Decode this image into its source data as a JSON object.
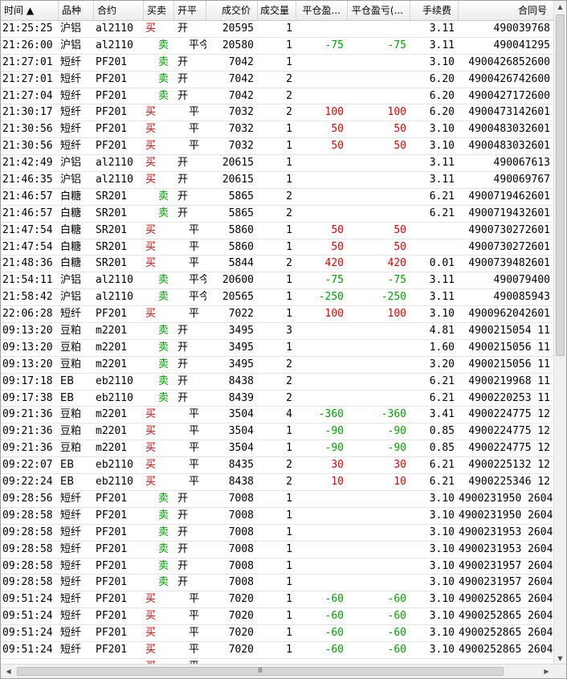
{
  "columns": [
    "时间 ▲",
    "品种",
    "合约",
    "买卖",
    "开平",
    "成交价",
    "成交量",
    "平仓盈...",
    "平仓盈亏(...",
    "手续费",
    "合同号"
  ],
  "rows": [
    [
      "21:25:25",
      "沪铝",
      "al2110",
      "买",
      "开",
      "20595",
      "1",
      "",
      "",
      "3.11",
      "490039768"
    ],
    [
      "21:26:00",
      "沪铝",
      "al2110",
      "卖",
      "平今",
      "20580",
      "1",
      "-75",
      "-75",
      "3.11",
      "490041295"
    ],
    [
      "21:27:01",
      "短纤",
      "PF201",
      "卖",
      "开",
      "7042",
      "1",
      "",
      "",
      "3.10",
      "4900426852600"
    ],
    [
      "21:27:01",
      "短纤",
      "PF201",
      "卖",
      "开",
      "7042",
      "2",
      "",
      "",
      "6.20",
      "4900426742600"
    ],
    [
      "21:27:04",
      "短纤",
      "PF201",
      "卖",
      "开",
      "7042",
      "2",
      "",
      "",
      "6.20",
      "4900427172600"
    ],
    [
      "21:30:17",
      "短纤",
      "PF201",
      "买",
      "平",
      "7032",
      "2",
      "100",
      "100",
      "6.20",
      "4900473142601"
    ],
    [
      "21:30:56",
      "短纤",
      "PF201",
      "买",
      "平",
      "7032",
      "1",
      "50",
      "50",
      "3.10",
      "4900483032601"
    ],
    [
      "21:30:56",
      "短纤",
      "PF201",
      "买",
      "平",
      "7032",
      "1",
      "50",
      "50",
      "3.10",
      "4900483032601"
    ],
    [
      "21:42:49",
      "沪铝",
      "al2110",
      "买",
      "开",
      "20615",
      "1",
      "",
      "",
      "3.11",
      "490067613"
    ],
    [
      "21:46:35",
      "沪铝",
      "al2110",
      "买",
      "开",
      "20615",
      "1",
      "",
      "",
      "3.11",
      "490069767"
    ],
    [
      "21:46:57",
      "白糖",
      "SR201",
      "卖",
      "开",
      "5865",
      "2",
      "",
      "",
      "6.21",
      "4900719462601"
    ],
    [
      "21:46:57",
      "白糖",
      "SR201",
      "卖",
      "开",
      "5865",
      "2",
      "",
      "",
      "6.21",
      "4900719432601"
    ],
    [
      "21:47:54",
      "白糖",
      "SR201",
      "买",
      "平",
      "5860",
      "1",
      "50",
      "50",
      "",
      "4900730272601"
    ],
    [
      "21:47:54",
      "白糖",
      "SR201",
      "买",
      "平",
      "5860",
      "1",
      "50",
      "50",
      "",
      "4900730272601"
    ],
    [
      "21:48:36",
      "白糖",
      "SR201",
      "买",
      "平",
      "5844",
      "2",
      "420",
      "420",
      "0.01",
      "4900739482601"
    ],
    [
      "21:54:11",
      "沪铝",
      "al2110",
      "卖",
      "平今",
      "20600",
      "1",
      "-75",
      "-75",
      "3.11",
      "490079400"
    ],
    [
      "21:58:42",
      "沪铝",
      "al2110",
      "卖",
      "平今",
      "20565",
      "1",
      "-250",
      "-250",
      "3.11",
      "490085943"
    ],
    [
      "22:06:28",
      "短纤",
      "PF201",
      "买",
      "平",
      "7022",
      "1",
      "100",
      "100",
      "3.10",
      "4900962042601"
    ],
    [
      "09:13:20",
      "豆粕",
      "m2201",
      "卖",
      "开",
      "3495",
      "3",
      "",
      "",
      "4.81",
      "4900215054    11"
    ],
    [
      "09:13:20",
      "豆粕",
      "m2201",
      "卖",
      "开",
      "3495",
      "1",
      "",
      "",
      "1.60",
      "4900215056    11"
    ],
    [
      "09:13:20",
      "豆粕",
      "m2201",
      "卖",
      "开",
      "3495",
      "2",
      "",
      "",
      "3.20",
      "4900215056    11"
    ],
    [
      "09:17:18",
      "EB",
      "eb2110",
      "卖",
      "开",
      "8438",
      "2",
      "",
      "",
      "6.21",
      "4900219968    11"
    ],
    [
      "09:17:38",
      "EB",
      "eb2110",
      "卖",
      "开",
      "8439",
      "2",
      "",
      "",
      "6.21",
      "4900220253    11"
    ],
    [
      "09:21:36",
      "豆粕",
      "m2201",
      "买",
      "平",
      "3504",
      "4",
      "-360",
      "-360",
      "3.41",
      "4900224775    12"
    ],
    [
      "09:21:36",
      "豆粕",
      "m2201",
      "买",
      "平",
      "3504",
      "1",
      "-90",
      "-90",
      "0.85",
      "4900224775    12"
    ],
    [
      "09:21:36",
      "豆粕",
      "m2201",
      "买",
      "平",
      "3504",
      "1",
      "-90",
      "-90",
      "0.85",
      "4900224775    12"
    ],
    [
      "09:22:07",
      "EB",
      "eb2110",
      "买",
      "平",
      "8435",
      "2",
      "30",
      "30",
      "6.21",
      "4900225132    12"
    ],
    [
      "09:22:24",
      "EB",
      "eb2110",
      "买",
      "平",
      "8438",
      "2",
      "10",
      "10",
      "6.21",
      "4900225346    12"
    ],
    [
      "09:28:56",
      "短纤",
      "PF201",
      "卖",
      "开",
      "7008",
      "1",
      "",
      "",
      "3.10",
      "4900231950 2604"
    ],
    [
      "09:28:58",
      "短纤",
      "PF201",
      "卖",
      "开",
      "7008",
      "1",
      "",
      "",
      "3.10",
      "4900231950 2604"
    ],
    [
      "09:28:58",
      "短纤",
      "PF201",
      "卖",
      "开",
      "7008",
      "1",
      "",
      "",
      "3.10",
      "4900231953 2604"
    ],
    [
      "09:28:58",
      "短纤",
      "PF201",
      "卖",
      "开",
      "7008",
      "1",
      "",
      "",
      "3.10",
      "4900231953 2604"
    ],
    [
      "09:28:58",
      "短纤",
      "PF201",
      "卖",
      "开",
      "7008",
      "1",
      "",
      "",
      "3.10",
      "4900231957 2604"
    ],
    [
      "09:28:58",
      "短纤",
      "PF201",
      "卖",
      "开",
      "7008",
      "1",
      "",
      "",
      "3.10",
      "4900231957 2604"
    ],
    [
      "09:51:24",
      "短纤",
      "PF201",
      "买",
      "平",
      "7020",
      "1",
      "-60",
      "-60",
      "3.10",
      "4900252865 2604"
    ],
    [
      "09:51:24",
      "短纤",
      "PF201",
      "买",
      "平",
      "7020",
      "1",
      "-60",
      "-60",
      "3.10",
      "4900252865 2604"
    ],
    [
      "09:51:24",
      "短纤",
      "PF201",
      "买",
      "平",
      "7020",
      "1",
      "-60",
      "-60",
      "3.10",
      "4900252865 2604"
    ],
    [
      "09:51:24",
      "短纤",
      "PF201",
      "买",
      "平",
      "7020",
      "1",
      "-60",
      "-60",
      "3.10",
      "4900252865 2604"
    ],
    [
      "",
      "",
      "",
      "买",
      "平",
      "",
      "",
      "",
      "",
      "",
      ""
    ]
  ],
  "scroll": {
    "up_icon": "scroll-up-arrow-icon",
    "down_icon": "scroll-down-arrow-icon",
    "left_icon": "scroll-left-arrow-icon",
    "right_icon": "scroll-right-arrow-icon",
    "grip_glyph": "Ⅲ"
  },
  "colors": {
    "buy": "#e00000",
    "sell": "#00a000",
    "profit": "#e00000",
    "loss": "#00a000"
  }
}
